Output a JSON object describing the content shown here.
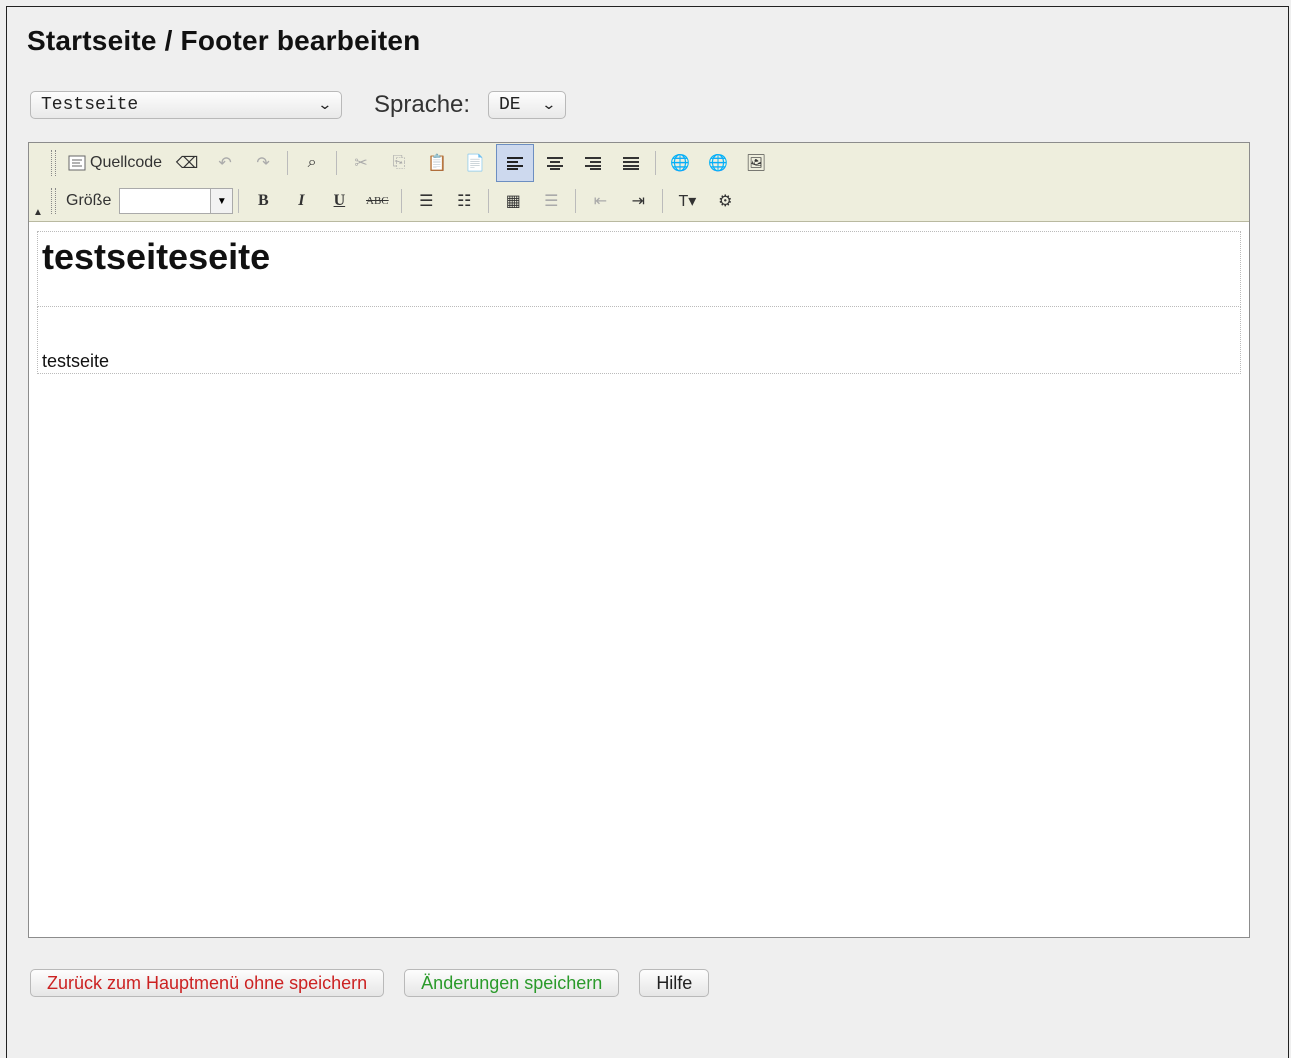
{
  "title": "Startseite / Footer bearbeiten",
  "page_select": {
    "value": "Testseite"
  },
  "language": {
    "label": "Sprache:",
    "value": "DE"
  },
  "toolbar": {
    "source_label": "Quellcode",
    "size_label": "Größe",
    "bold_label": "B",
    "italic_label": "I",
    "underline_label": "U",
    "strike_label": "ABC"
  },
  "content": {
    "heading": "testseiteseite",
    "paragraph": "testseite"
  },
  "buttons": {
    "back": "Zurück zum Hauptmenü ohne speichern",
    "save": "Änderungen speichern",
    "help": "Hilfe"
  },
  "colors": {
    "back": "#cc2222",
    "save": "#2a9a2a",
    "toolbar_bg": "#eeeedd"
  }
}
